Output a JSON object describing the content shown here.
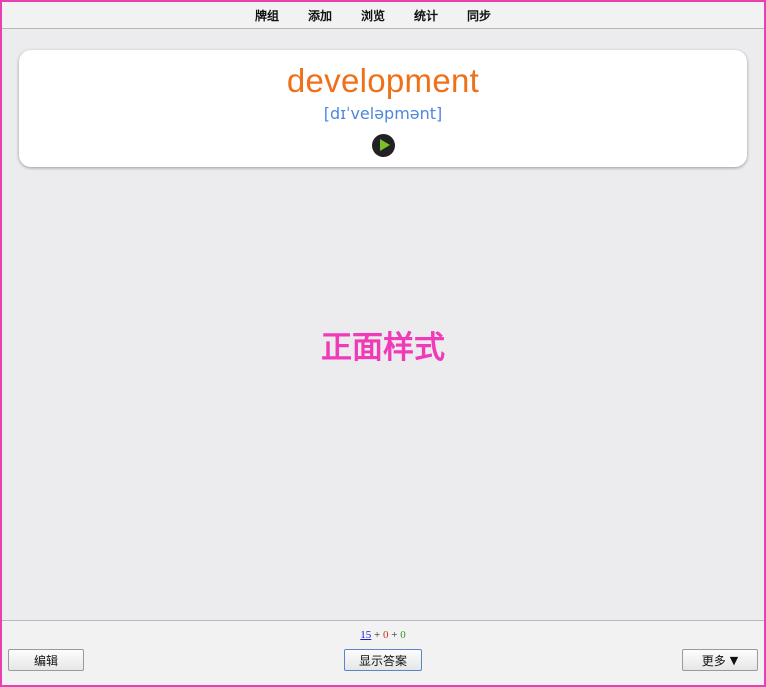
{
  "nav": {
    "items": [
      "牌组",
      "添加",
      "浏览",
      "统计",
      "同步"
    ]
  },
  "card": {
    "word": "development",
    "phonetic": "[dɪˈveləpmənt]",
    "play_icon": "play-icon"
  },
  "body": {
    "front_style_label": "正面样式"
  },
  "counts": {
    "new": "15",
    "learning": "0",
    "review": "0",
    "separator": "+"
  },
  "buttons": {
    "edit": "编辑",
    "show_answer": "显示答案",
    "more": "更多",
    "more_arrow": "▼"
  },
  "colors": {
    "frame": "#e83fb2",
    "word": "#f0701a",
    "phonetic": "#4f86e0",
    "front_style": "#f03ab8",
    "count_new": "#1a1ad0",
    "count_learning": "#c8321e",
    "count_review": "#2a9a2a"
  }
}
